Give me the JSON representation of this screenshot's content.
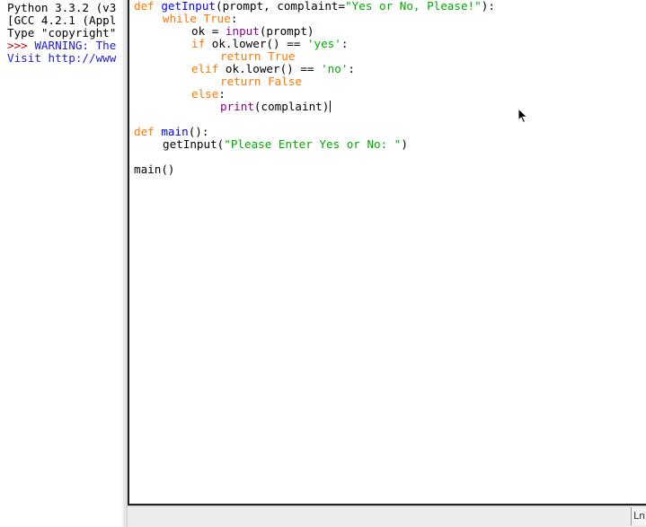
{
  "shell": {
    "lines": [
      "Python 3.3.2 (v3",
      "[GCC 4.2.1 (Appl",
      "Type \"copyright\"",
      ">>> ",
      "WARNING: The",
      "Visit http://www"
    ]
  },
  "editor": {
    "code": {
      "l1_def": "def ",
      "l1_name": "getInput",
      "l1_args": "(prompt, complaint=",
      "l1_str": "\"Yes or No, Please!\"",
      "l1_end": "):",
      "l2_kw": "while True",
      "l2_end": ":",
      "l3_pre": "ok = ",
      "l3_bi": "input",
      "l3_end": "(prompt)",
      "l4_kw": "if",
      "l4_mid": " ok.lower() == ",
      "l4_str": "'yes'",
      "l4_end": ":",
      "l5_kw": "return True",
      "l6_kw": "elif",
      "l6_mid": " ok.lower() == ",
      "l6_str": "'no'",
      "l6_end": ":",
      "l7_kw": "return False",
      "l8_kw": "else",
      "l8_end": ":",
      "l9_bi": "print",
      "l9_end": "(complaint)",
      "l11_def": "def ",
      "l11_name": "main",
      "l11_end": "():",
      "l12_pre": "getInput(",
      "l12_str": "\"Please Enter Yes or No: \"",
      "l12_end": ")",
      "l14": "main()"
    }
  },
  "statusbar": {
    "line_col": "Ln"
  },
  "colors": {
    "keyword": "#ff7700",
    "function_name": "#0000ff",
    "string": "#00aa00",
    "builtin": "#900090",
    "shell_prompt": "#c00000"
  },
  "icons": {
    "pointer": "mouse-pointer-icon"
  }
}
